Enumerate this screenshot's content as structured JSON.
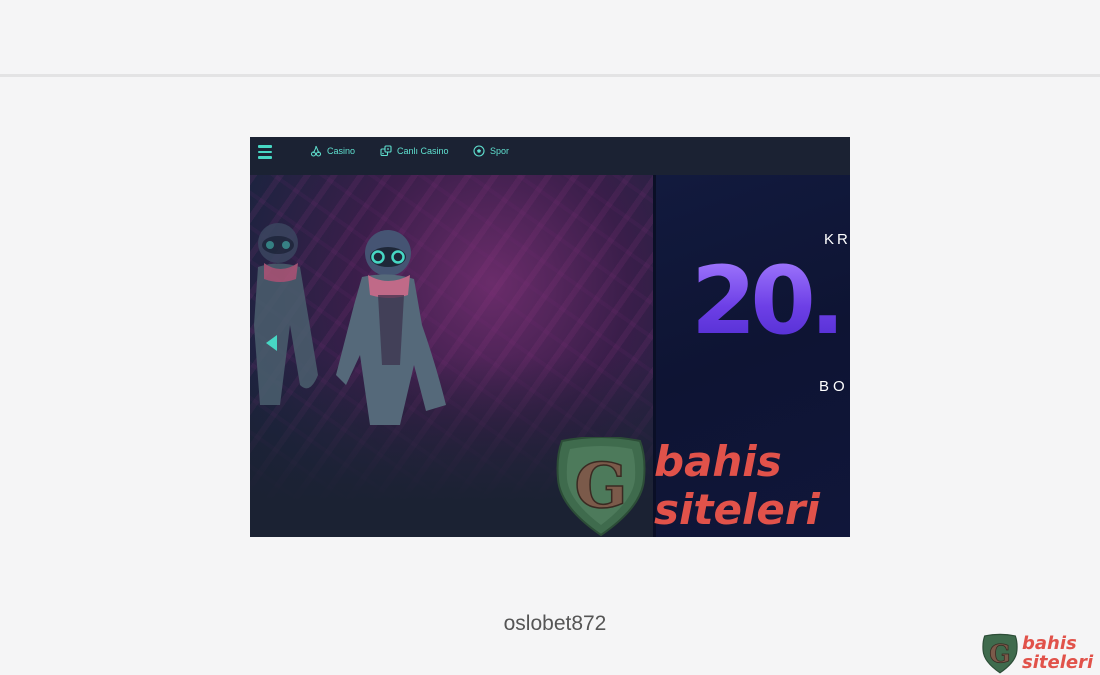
{
  "embedded_screenshot": {
    "nav": {
      "items": [
        {
          "label": "Casino",
          "icon": "cherries-icon"
        },
        {
          "label": "Canlı Casino",
          "icon": "dice-icon"
        },
        {
          "label": "Spor",
          "icon": "soccer-ball-icon"
        }
      ]
    },
    "promo": {
      "top_text": "KR",
      "big_text": "20.",
      "bottom_text": "BO"
    },
    "watermark": {
      "line1": "bahis",
      "line2": "siteleri",
      "emblem_letter": "G"
    }
  },
  "caption": "oslobet872",
  "corner_watermark": {
    "line1": "bahis",
    "line2": "siteleri",
    "emblem_letter": "G"
  },
  "colors": {
    "accent_teal": "#47d7c4",
    "promo_purple": "#7a4cf0",
    "watermark_red": "#e1524a",
    "emblem_green": "#3f6b4d"
  }
}
